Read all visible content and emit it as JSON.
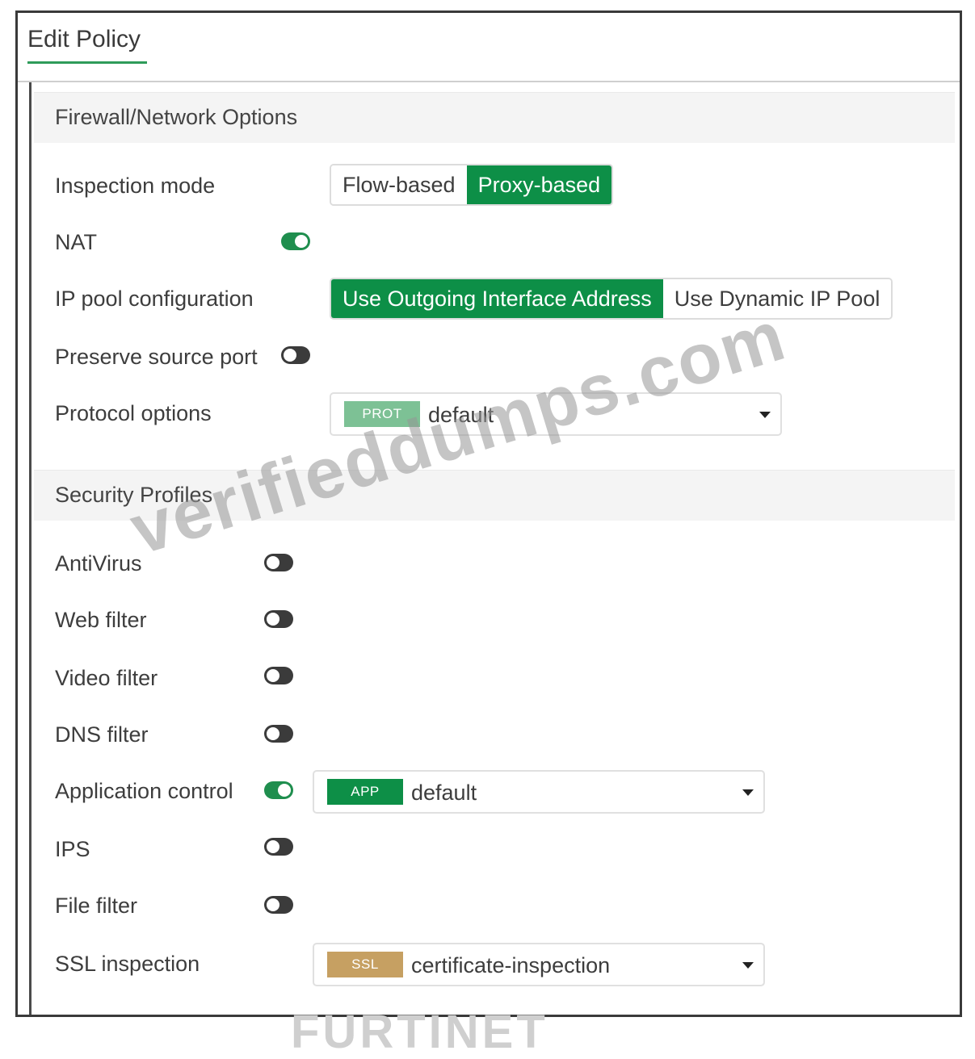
{
  "window": {
    "title": "Edit Policy"
  },
  "firewall_section": {
    "header": "Firewall/Network Options",
    "inspection_mode": {
      "label": "Inspection mode",
      "options": [
        "Flow-based",
        "Proxy-based"
      ],
      "selected": "Proxy-based"
    },
    "nat": {
      "label": "NAT",
      "enabled": true
    },
    "ip_pool": {
      "label": "IP pool configuration",
      "options": [
        "Use Outgoing Interface Address",
        "Use Dynamic IP Pool"
      ],
      "selected": "Use Outgoing Interface Address"
    },
    "preserve_source_port": {
      "label": "Preserve source port",
      "enabled": false
    },
    "protocol_options": {
      "label": "Protocol options",
      "tag": "PROT",
      "value": "default",
      "tag_color": "#7dc195"
    }
  },
  "security_section": {
    "header": "Security Profiles",
    "antivirus": {
      "label": "AntiVirus",
      "enabled": false
    },
    "web_filter": {
      "label": "Web filter",
      "enabled": false
    },
    "video_filter": {
      "label": "Video filter",
      "enabled": false
    },
    "dns_filter": {
      "label": "DNS filter",
      "enabled": false
    },
    "application_control": {
      "label": "Application control",
      "enabled": true,
      "tag": "APP",
      "value": "default",
      "tag_color": "#0d8f47"
    },
    "ips": {
      "label": "IPS",
      "enabled": false
    },
    "file_filter": {
      "label": "File filter",
      "enabled": false
    },
    "ssl_inspection": {
      "label": "SSL inspection",
      "tag": "SSL",
      "value": "certificate-inspection",
      "tag_color": "#c6a062"
    }
  },
  "colors": {
    "accent": "#0d8f47",
    "toggle_off": "#3b3b3b"
  },
  "watermark": "verifieddumps.com",
  "logo": "FURTINET"
}
